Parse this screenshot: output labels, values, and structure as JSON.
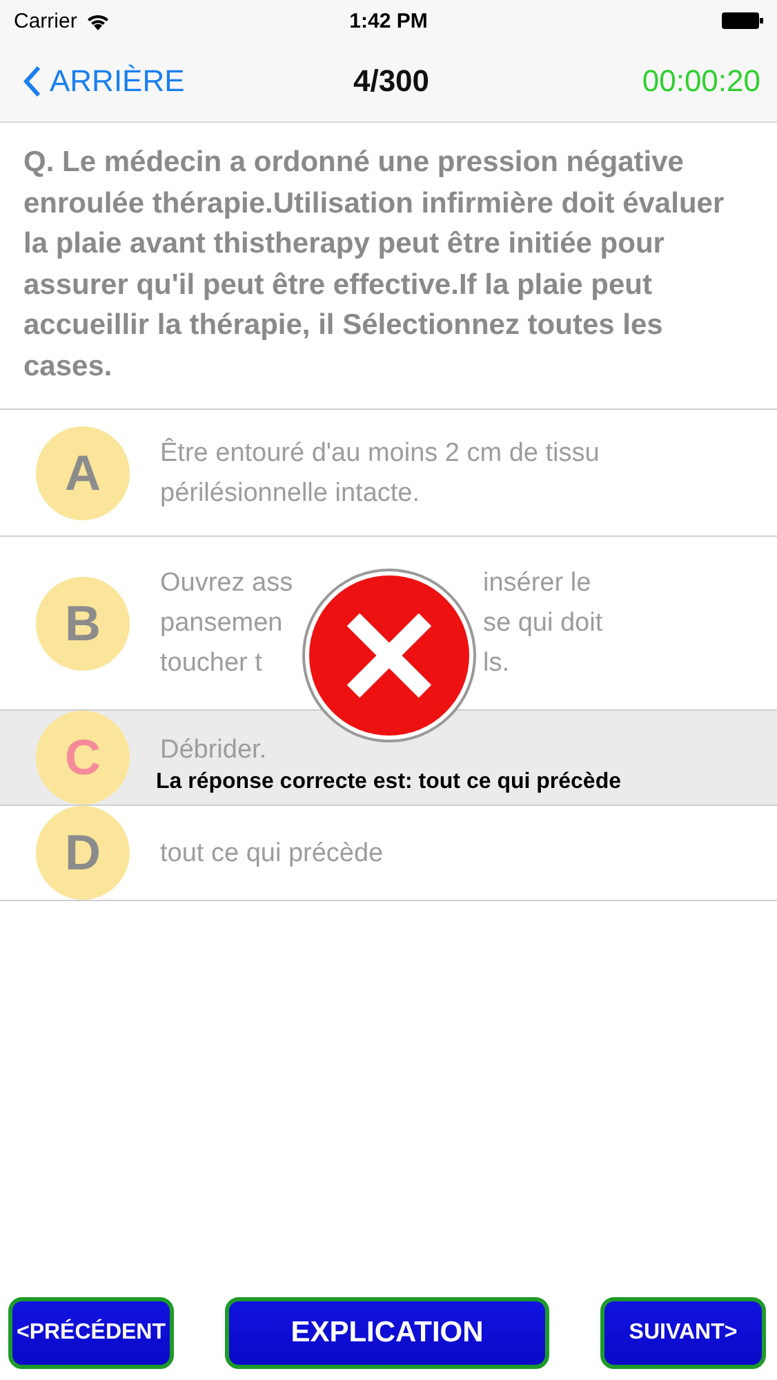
{
  "status_bar": {
    "carrier": "Carrier",
    "time": "1:42 PM"
  },
  "nav": {
    "back": "ARRIÈRE",
    "title": "4/300",
    "timer": "00:00:20"
  },
  "question": "Q. Le médecin a ordonné une pression négative enroulée thérapie.Utilisation infirmière doit évaluer la plaie avant thistherapy peut être initiée pour assurer qu'il peut être effective.If la plaie peut accueillir la thérapie, il Sélectionnez toutes les cases.",
  "options": [
    {
      "letter": "A",
      "selected": false,
      "lines": [
        [
          "Être entouré d'au moins 2 cm de tissu"
        ],
        [
          "périlésionnelle intacte."
        ]
      ]
    },
    {
      "letter": "B",
      "selected": false,
      "lines": [
        [
          "Ouvrez ass",
          "insérer le"
        ],
        [
          "pansemen",
          "se qui doit"
        ],
        [
          "toucher t",
          "ls."
        ]
      ]
    },
    {
      "letter": "C",
      "selected": true,
      "lines": [
        [
          "Débrider."
        ]
      ]
    },
    {
      "letter": "D",
      "selected": false,
      "lines": [
        [
          "tout ce qui précède"
        ]
      ]
    }
  ],
  "result": {
    "correct": false,
    "message": "La réponse correcte est:  tout ce qui précède"
  },
  "buttons": {
    "previous": "<PRÉCÉDENT",
    "explain": "EXPLICATION",
    "next": "SUIVANT>"
  }
}
